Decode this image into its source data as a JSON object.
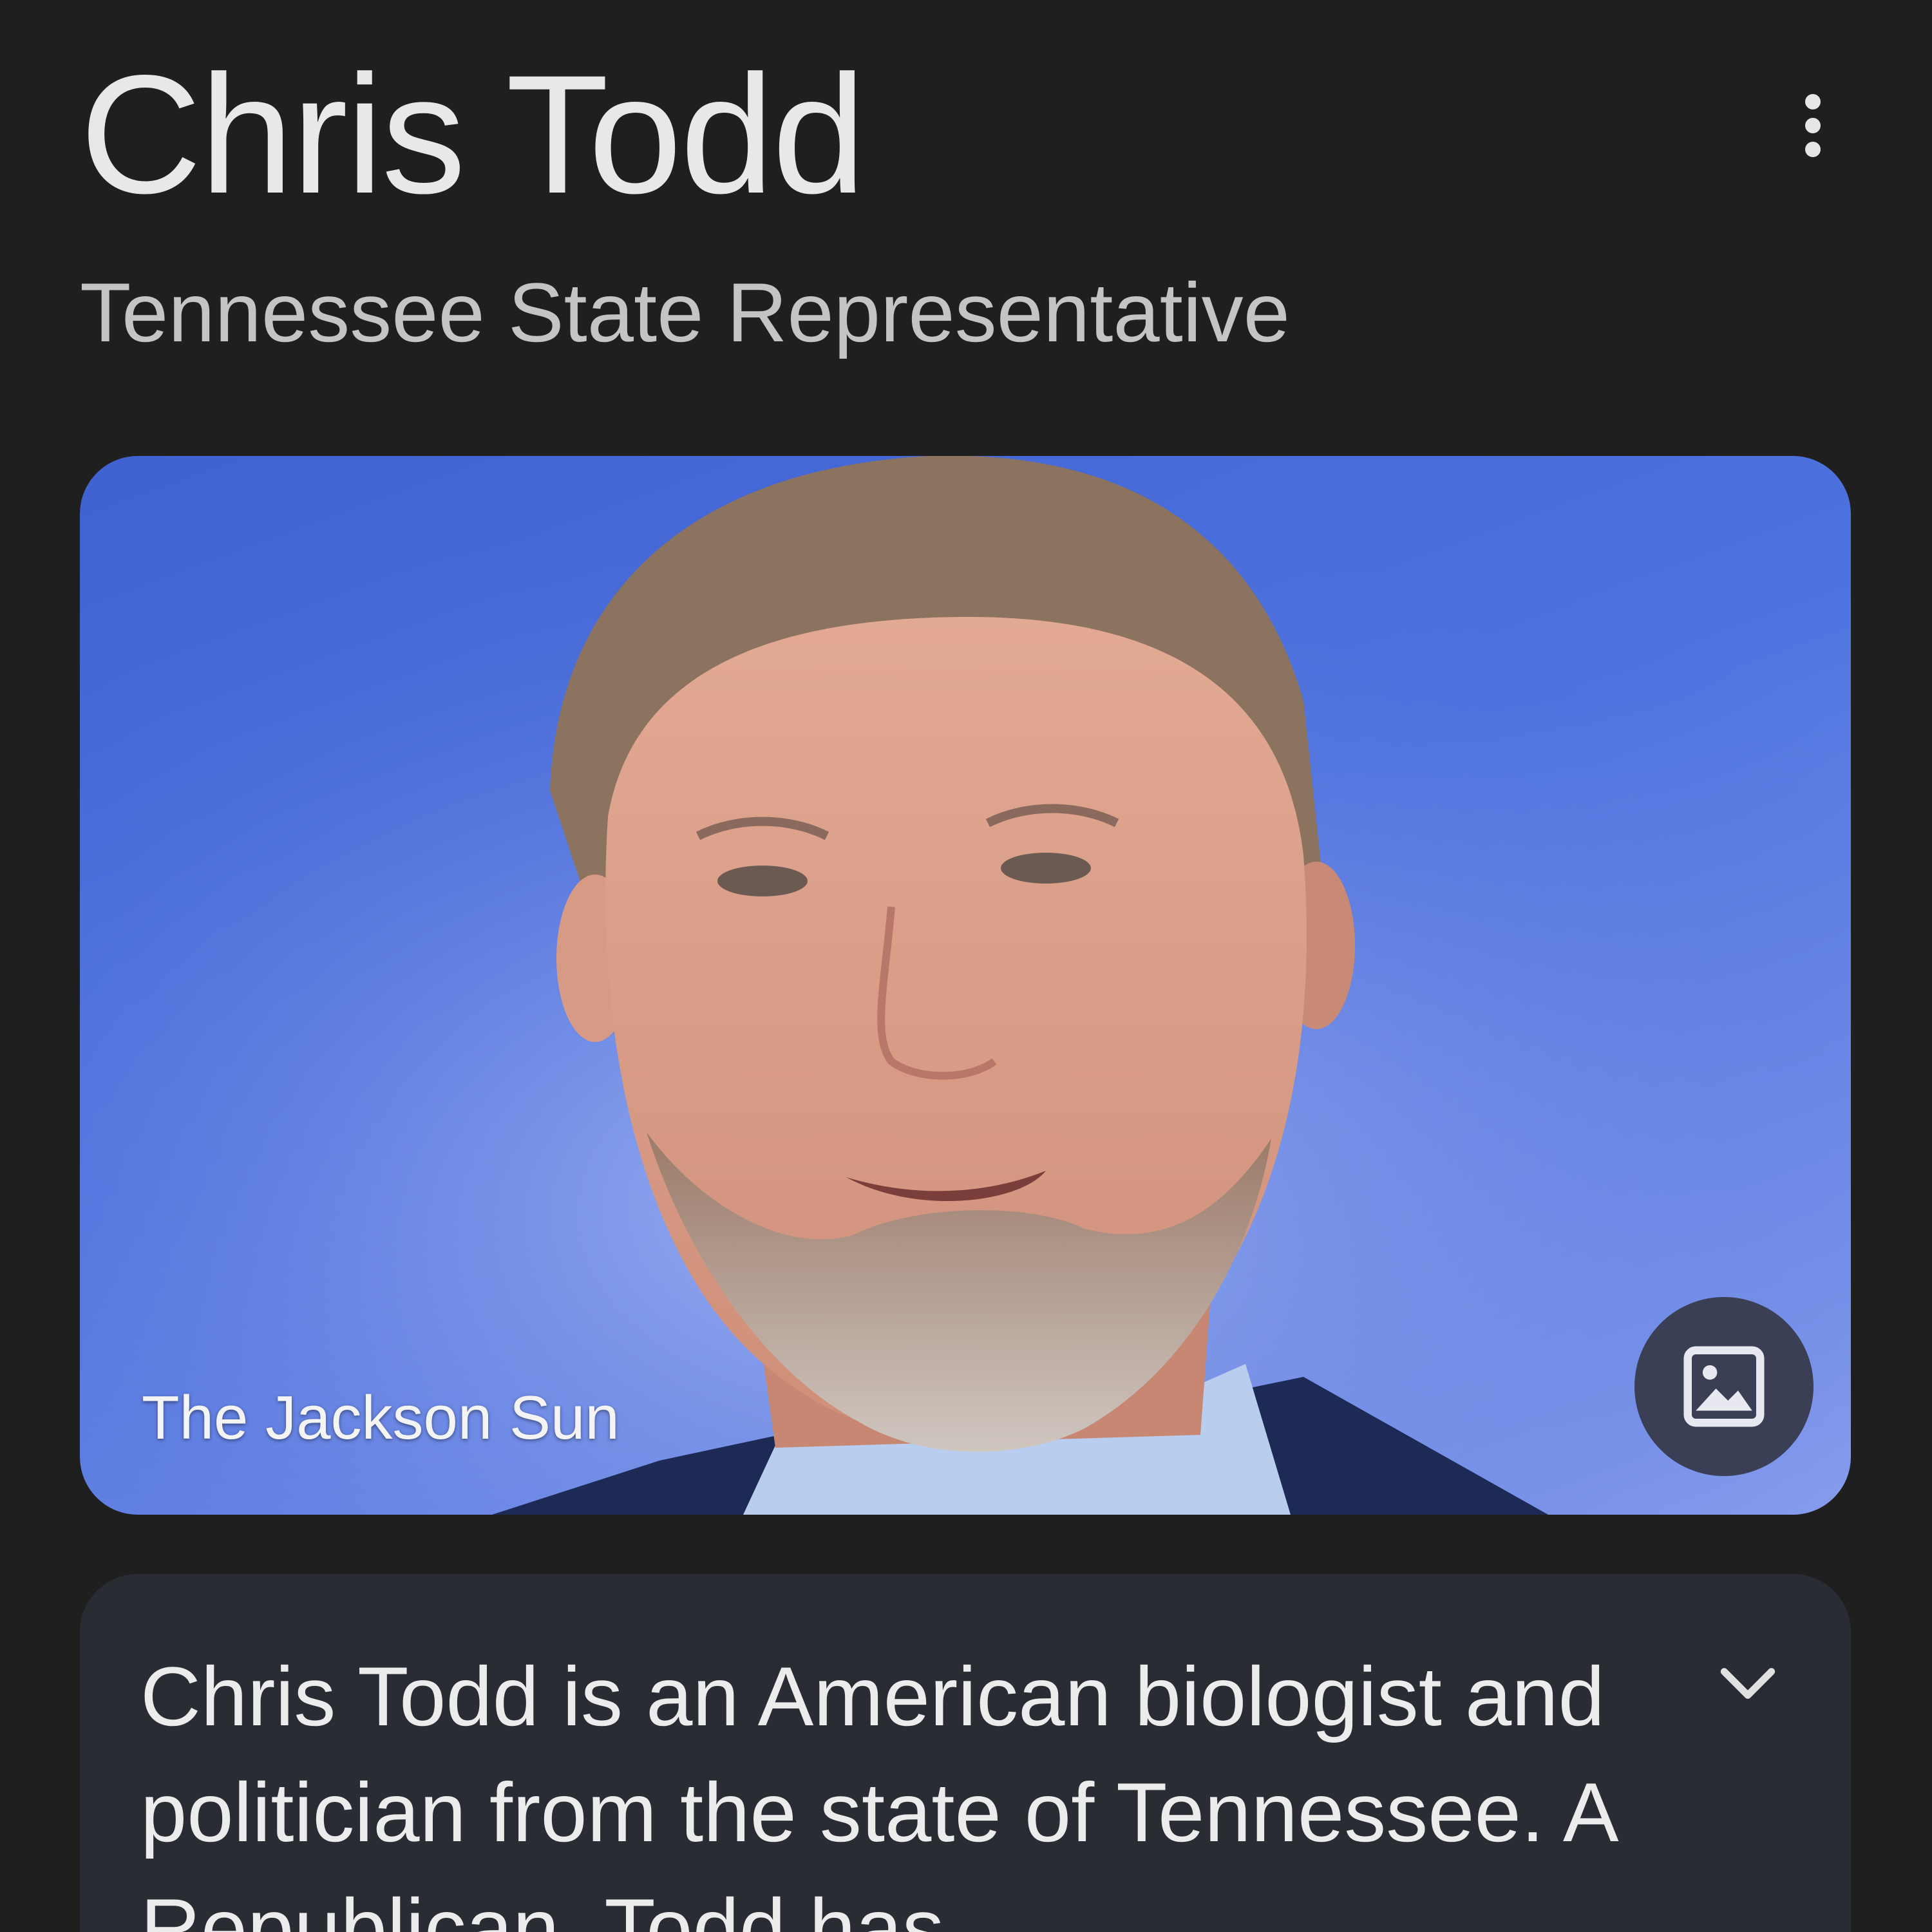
{
  "header": {
    "title": "Chris Todd",
    "subtitle": "Tennessee State Representative",
    "more_icon": "more-vert-icon"
  },
  "image": {
    "source_label": "The Jackson Sun",
    "button_icon": "image-icon",
    "background_color": "#4e73df"
  },
  "description": {
    "text": "Chris Todd is an American biologist and politician from the state of Tennessee. A Republican, Todd has",
    "expand_icon": "chevron-down-icon"
  },
  "colors": {
    "background": "#1f1f1f",
    "card": "#2a2c34",
    "title_text": "#e8e8e8",
    "subtitle_text": "#c4c4c4"
  }
}
